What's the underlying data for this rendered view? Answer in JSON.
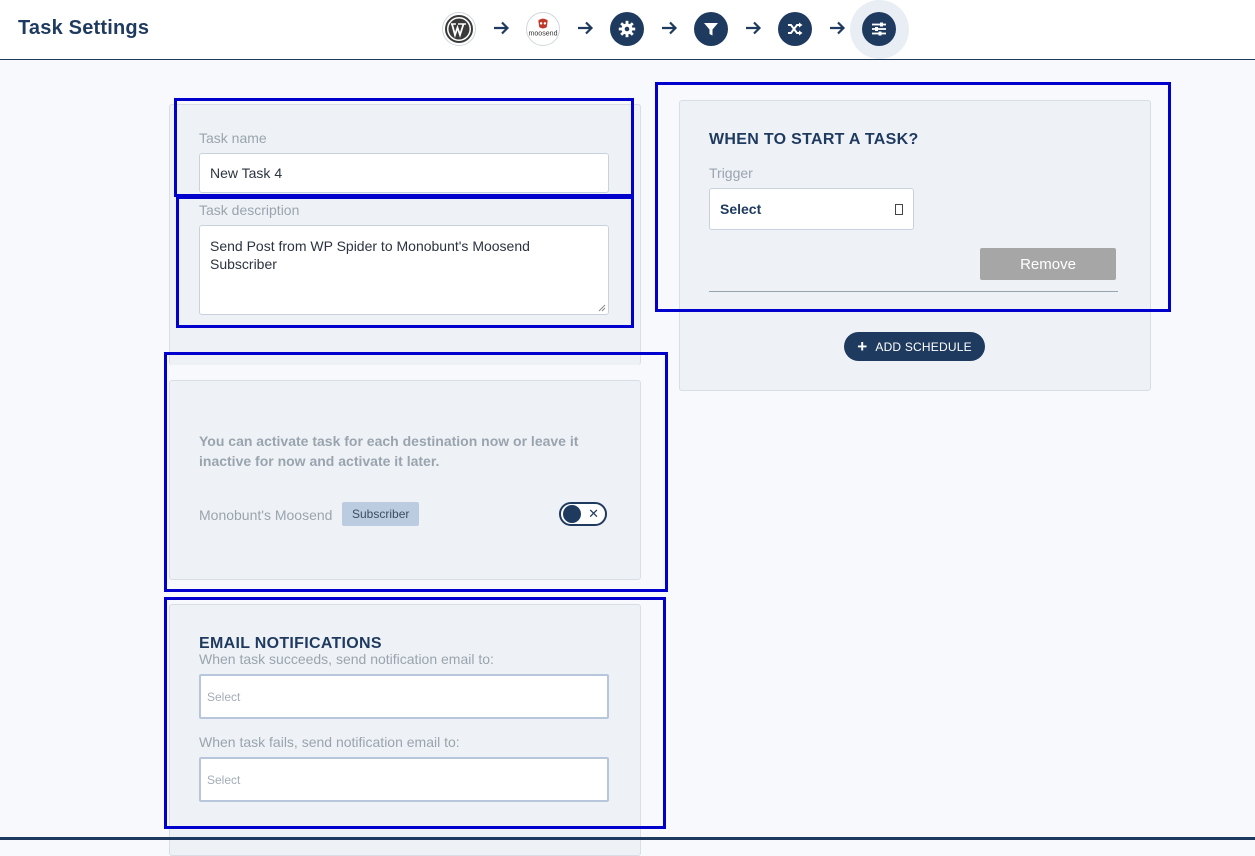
{
  "header": {
    "title": "Task Settings",
    "steps": [
      {
        "icon": "wordpress-icon"
      },
      {
        "icon": "moosend-logo-icon",
        "logo_text": "moosend"
      },
      {
        "icon": "gear-icon"
      },
      {
        "icon": "filter-icon"
      },
      {
        "icon": "shuffle-icon"
      },
      {
        "icon": "sliders-icon",
        "active": true
      }
    ]
  },
  "task": {
    "name_label": "Task name",
    "name_value": "New Task 4",
    "description_label": "Task description",
    "description_value": "Send Post from WP Spider to Monobunt's Moosend Subscriber"
  },
  "activation": {
    "info": "You can activate task for each destination now or leave it inactive for now and activate it later.",
    "destination_name": "Monobunt's Moosend",
    "destination_badge": "Subscriber",
    "toggle_symbol": "✕"
  },
  "email_notifications": {
    "heading": "EMAIL NOTIFICATIONS",
    "success_label": "When task succeeds, send notification email to:",
    "success_placeholder": "Select",
    "fail_label": "When task fails, send notification email to:",
    "fail_placeholder": "Select"
  },
  "schedule": {
    "heading": "WHEN TO START A TASK?",
    "trigger_label": "Trigger",
    "trigger_value": "Select",
    "remove_label": "Remove",
    "add_label": "ADD SCHEDULE",
    "add_symbol": "+"
  },
  "colors": {
    "primary": "#1f3a5f",
    "highlight": "#0000cc",
    "card_bg": "#eef2f6"
  }
}
